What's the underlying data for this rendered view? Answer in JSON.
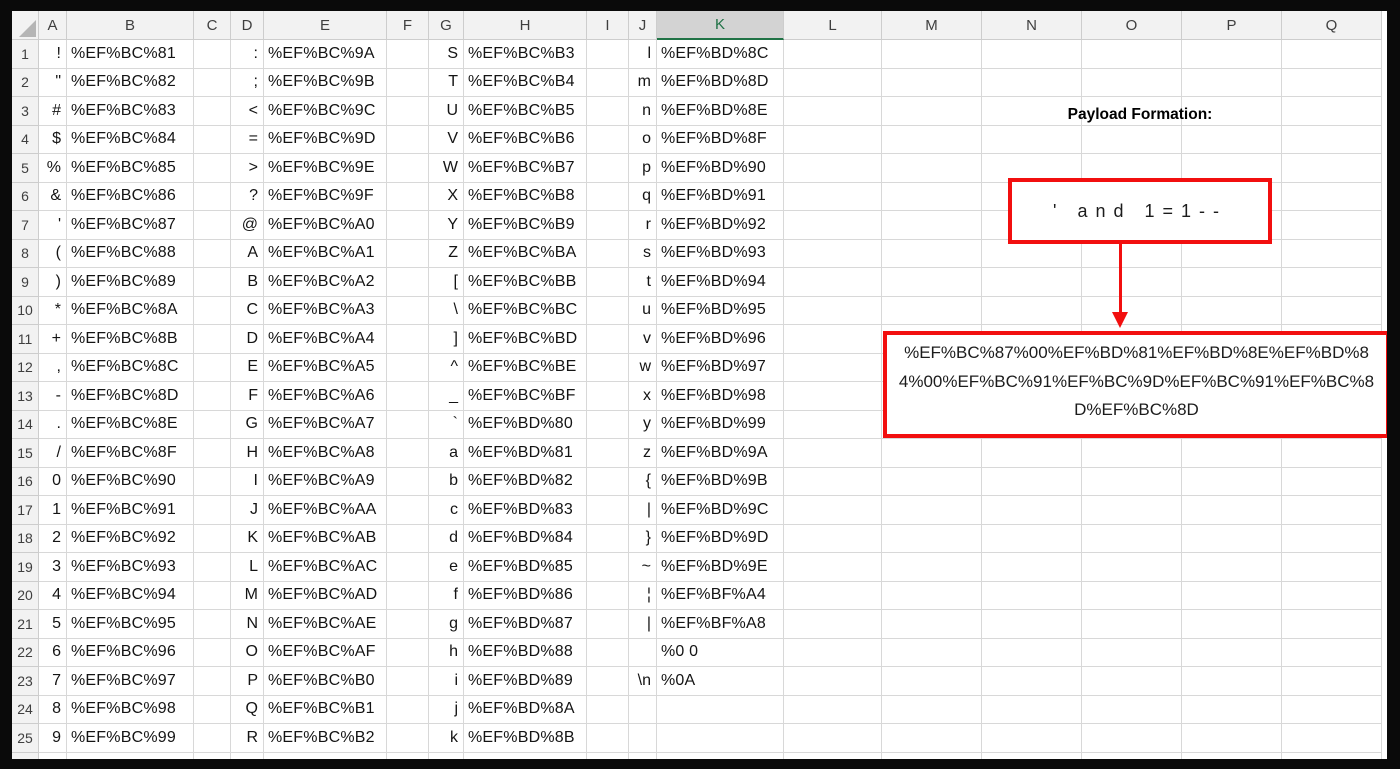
{
  "spreadsheet": {
    "column_headers": [
      "A",
      "B",
      "C",
      "D",
      "E",
      "F",
      "G",
      "H",
      "I",
      "J",
      "K",
      "L",
      "M",
      "N",
      "O",
      "P",
      "Q"
    ],
    "selected_column_header": "K",
    "char_columns": [
      "A",
      "D",
      "G",
      "J"
    ],
    "rows": [
      {
        "num": "1",
        "A": "!",
        "B": "%EF%BC%81",
        "D": ":",
        "E": "%EF%BC%9A",
        "G": "S",
        "H": "%EF%BC%B3",
        "J": "l",
        "K": "%EF%BD%8C"
      },
      {
        "num": "2",
        "A": "\"",
        "B": "%EF%BC%82",
        "D": ";",
        "E": "%EF%BC%9B",
        "G": "T",
        "H": "%EF%BC%B4",
        "J": "m",
        "K": "%EF%BD%8D"
      },
      {
        "num": "3",
        "A": "#",
        "B": "%EF%BC%83",
        "D": "<",
        "E": "%EF%BC%9C",
        "G": "U",
        "H": "%EF%BC%B5",
        "J": "n",
        "K": "%EF%BD%8E"
      },
      {
        "num": "4",
        "A": "$",
        "B": "%EF%BC%84",
        "D": "=",
        "E": "%EF%BC%9D",
        "G": "V",
        "H": "%EF%BC%B6",
        "J": "o",
        "K": "%EF%BD%8F"
      },
      {
        "num": "5",
        "A": "%",
        "B": "%EF%BC%85",
        "D": ">",
        "E": "%EF%BC%9E",
        "G": "W",
        "H": "%EF%BC%B7",
        "J": "p",
        "K": "%EF%BD%90"
      },
      {
        "num": "6",
        "A": "&",
        "B": "%EF%BC%86",
        "D": "?",
        "E": "%EF%BC%9F",
        "G": "X",
        "H": "%EF%BC%B8",
        "J": "q",
        "K": "%EF%BD%91"
      },
      {
        "num": "7",
        "A": "'",
        "B": "%EF%BC%87",
        "D": "@",
        "E": "%EF%BC%A0",
        "G": "Y",
        "H": "%EF%BC%B9",
        "J": "r",
        "K": "%EF%BD%92"
      },
      {
        "num": "8",
        "A": "(",
        "B": "%EF%BC%88",
        "D": "A",
        "E": "%EF%BC%A1",
        "G": "Z",
        "H": "%EF%BC%BA",
        "J": "s",
        "K": "%EF%BD%93"
      },
      {
        "num": "9",
        "A": ")",
        "B": "%EF%BC%89",
        "D": "B",
        "E": "%EF%BC%A2",
        "G": "[",
        "H": "%EF%BC%BB",
        "J": "t",
        "K": "%EF%BD%94"
      },
      {
        "num": "10",
        "A": "*",
        "B": "%EF%BC%8A",
        "D": "C",
        "E": "%EF%BC%A3",
        "G": "\\",
        "H": "%EF%BC%BC",
        "J": "u",
        "K": "%EF%BD%95"
      },
      {
        "num": "11",
        "A": "+",
        "B": "%EF%BC%8B",
        "D": "D",
        "E": "%EF%BC%A4",
        "G": "]",
        "H": "%EF%BC%BD",
        "J": "v",
        "K": "%EF%BD%96"
      },
      {
        "num": "12",
        "A": ",",
        "B": "%EF%BC%8C",
        "D": "E",
        "E": "%EF%BC%A5",
        "G": "^",
        "H": "%EF%BC%BE",
        "J": "w",
        "K": "%EF%BD%97"
      },
      {
        "num": "13",
        "A": "-",
        "B": "%EF%BC%8D",
        "D": "F",
        "E": "%EF%BC%A6",
        "G": "_",
        "H": "%EF%BC%BF",
        "J": "x",
        "K": "%EF%BD%98"
      },
      {
        "num": "14",
        "A": ".",
        "B": "%EF%BC%8E",
        "D": "G",
        "E": "%EF%BC%A7",
        "G": "`",
        "H": "%EF%BD%80",
        "J": "y",
        "K": "%EF%BD%99"
      },
      {
        "num": "15",
        "A": "/",
        "B": "%EF%BC%8F",
        "D": "H",
        "E": "%EF%BC%A8",
        "G": "a",
        "H": "%EF%BD%81",
        "J": "z",
        "K": "%EF%BD%9A"
      },
      {
        "num": "16",
        "A": "0",
        "B": "%EF%BC%90",
        "D": "I",
        "E": "%EF%BC%A9",
        "G": "b",
        "H": "%EF%BD%82",
        "J": "{",
        "K": "%EF%BD%9B"
      },
      {
        "num": "17",
        "A": "1",
        "B": "%EF%BC%91",
        "D": "J",
        "E": "%EF%BC%AA",
        "G": "c",
        "H": "%EF%BD%83",
        "J": "|",
        "K": "%EF%BD%9C"
      },
      {
        "num": "18",
        "A": "2",
        "B": "%EF%BC%92",
        "D": "K",
        "E": "%EF%BC%AB",
        "G": "d",
        "H": "%EF%BD%84",
        "J": "}",
        "K": "%EF%BD%9D"
      },
      {
        "num": "19",
        "A": "3",
        "B": "%EF%BC%93",
        "D": "L",
        "E": "%EF%BC%AC",
        "G": "e",
        "H": "%EF%BD%85",
        "J": "~",
        "K": "%EF%BD%9E"
      },
      {
        "num": "20",
        "A": "4",
        "B": "%EF%BC%94",
        "D": "M",
        "E": "%EF%BC%AD",
        "G": "f",
        "H": "%EF%BD%86",
        "J": "¦",
        "K": "%EF%BF%A4"
      },
      {
        "num": "21",
        "A": "5",
        "B": "%EF%BC%95",
        "D": "N",
        "E": "%EF%BC%AE",
        "G": "g",
        "H": "%EF%BD%87",
        "J": "|",
        "K": "%EF%BF%A8"
      },
      {
        "num": "22",
        "A": "6",
        "B": "%EF%BC%96",
        "D": "O",
        "E": "%EF%BC%AF",
        "G": "h",
        "H": "%EF%BD%88",
        "K": "%0 0"
      },
      {
        "num": "23",
        "A": "7",
        "B": "%EF%BC%97",
        "D": "P",
        "E": "%EF%BC%B0",
        "G": "i",
        "H": "%EF%BD%89",
        "J": "\\n",
        "K": "%0A"
      },
      {
        "num": "24",
        "A": "8",
        "B": "%EF%BC%98",
        "D": "Q",
        "E": "%EF%BC%B1",
        "G": "j",
        "H": "%EF%BD%8A"
      },
      {
        "num": "25",
        "A": "9",
        "B": "%EF%BC%99",
        "D": "R",
        "E": "%EF%BC%B2",
        "G": "k",
        "H": "%EF%BD%8B"
      }
    ]
  },
  "annotations": {
    "title": "Payload Formation:",
    "input_text": "' and 1=1--",
    "payload_text": "%EF%BC%87%00%EF%BD%81%EF%BD%8E%EF%BD%84%00%EF%BC%91%EF%BC%9D%EF%BC%91%EF%BC%8D%EF%BC%8D"
  },
  "colors": {
    "annotation_red": "#f20f0f",
    "selected_header_green": "#217346",
    "header_background": "#f2f2f2",
    "selected_header_background": "#d3d3d3",
    "gridline": "#d8d8d8"
  }
}
